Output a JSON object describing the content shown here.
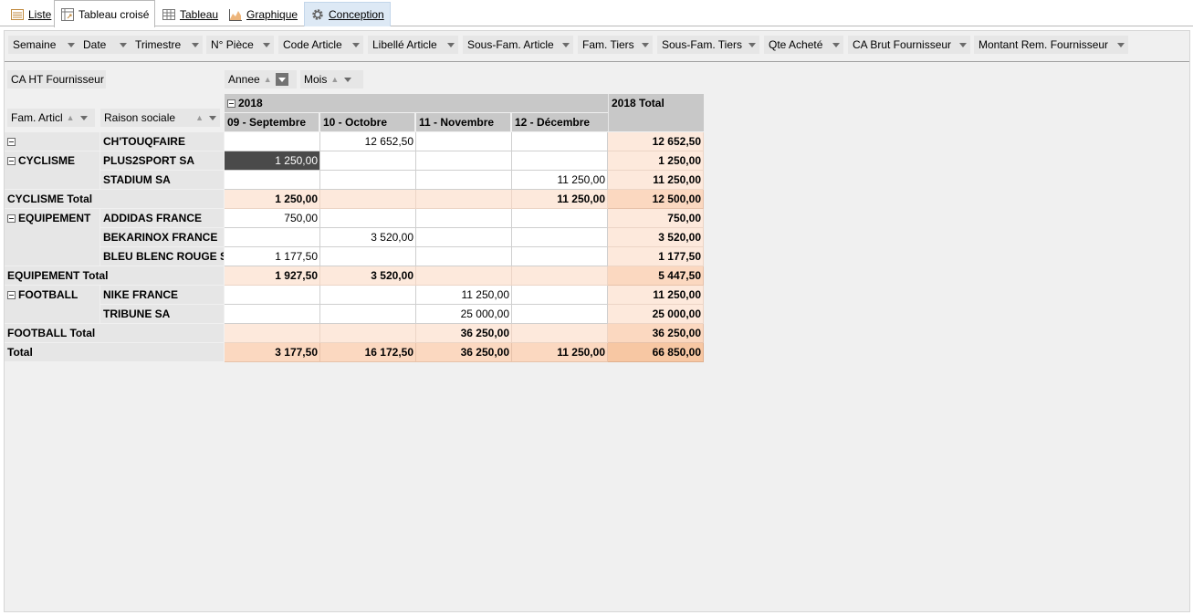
{
  "tabs": [
    {
      "label": "Liste",
      "icon": "list-icon"
    },
    {
      "label": "Tableau croisé",
      "icon": "pivot-table-icon"
    },
    {
      "label": "Tableau",
      "icon": "table-icon"
    },
    {
      "label": "Graphique",
      "icon": "chart-icon"
    },
    {
      "label": "Conception",
      "icon": "gear-icon"
    }
  ],
  "filter_fields": [
    "Semaine",
    "Date",
    "Trimestre",
    "N° Pièce",
    "Code Article",
    "Libellé Article",
    "Sous-Fam. Article",
    "Fam. Tiers",
    "Sous-Fam. Tiers",
    "Qte Acheté",
    "CA Brut Fournisseur",
    "Montant Rem. Fournisseur"
  ],
  "pivot": {
    "data_field": "CA HT Fournisseur",
    "column_fields": [
      "Annee",
      "Mois"
    ],
    "row_fields": [
      "Fam. Articl",
      "Raison sociale"
    ],
    "year": "2018",
    "year_total_label": "2018 Total",
    "months": [
      "09 - Septembre",
      "10 - Octobre",
      "11 - Novembre",
      "12 - Décembre"
    ],
    "rows": [
      {
        "group": "",
        "supplier": "CH'TOUQFAIRE",
        "values": [
          "",
          "12 652,50",
          "",
          ""
        ],
        "total": "12 652,50"
      },
      {
        "group": "CYCLISME",
        "supplier": "PLUS2SPORT SA",
        "values": [
          "1 250,00",
          "",
          "",
          ""
        ],
        "total": "1 250,00"
      },
      {
        "group": "",
        "supplier": "STADIUM SA",
        "values": [
          "",
          "",
          "",
          "11 250,00"
        ],
        "total": "11 250,00"
      },
      {
        "subtotal": "CYCLISME Total",
        "values": [
          "1 250,00",
          "",
          "",
          "11 250,00"
        ],
        "total": "12 500,00"
      },
      {
        "group": "EQUIPEMENT",
        "supplier": "ADDIDAS FRANCE",
        "values": [
          "750,00",
          "",
          "",
          ""
        ],
        "total": "750,00"
      },
      {
        "group": "",
        "supplier": "BEKARINOX FRANCE",
        "values": [
          "",
          "3 520,00",
          "",
          ""
        ],
        "total": "3 520,00"
      },
      {
        "group": "",
        "supplier": "BLEU BLENC ROUGE SA",
        "values": [
          "1 177,50",
          "",
          "",
          ""
        ],
        "total": "1 177,50"
      },
      {
        "subtotal": "EQUIPEMENT Total",
        "values": [
          "1 927,50",
          "3 520,00",
          "",
          ""
        ],
        "total": "5 447,50"
      },
      {
        "group": "FOOTBALL",
        "supplier": "NIKE FRANCE",
        "values": [
          "",
          "",
          "11 250,00",
          ""
        ],
        "total": "11 250,00"
      },
      {
        "group": "",
        "supplier": "TRIBUNE SA",
        "values": [
          "",
          "",
          "25 000,00",
          ""
        ],
        "total": "25 000,00"
      },
      {
        "subtotal": "FOOTBALL Total",
        "values": [
          "",
          "",
          "36 250,00",
          ""
        ],
        "total": "36 250,00"
      }
    ],
    "grand_total": {
      "label": "Total",
      "values": [
        "3 177,50",
        "16 172,50",
        "36 250,00",
        "11 250,00"
      ],
      "total": "66 850,00"
    }
  }
}
